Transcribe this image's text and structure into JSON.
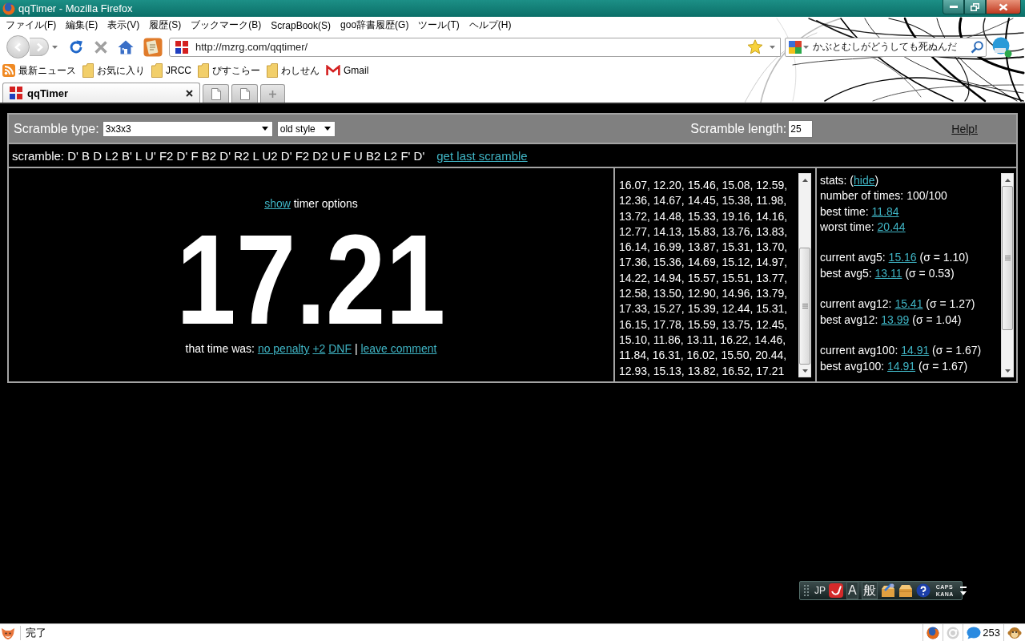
{
  "window": {
    "title": "qqTimer - Mozilla Firefox"
  },
  "menu_bar": [
    "ファイル(F)",
    "編集(E)",
    "表示(V)",
    "履歴(S)",
    "ブックマーク(B)",
    "ScrapBook(S)",
    "goo辞書履歴(G)",
    "ツール(T)",
    "ヘルプ(H)"
  ],
  "navigation": {
    "url": "http://mzrg.com/qqtimer/",
    "search_value": "かぶとむしがどうしても死ぬんだ"
  },
  "bookmarks": [
    {
      "kind": "feed",
      "label": "最新ニュース"
    },
    {
      "kind": "folder",
      "label": "お気に入り"
    },
    {
      "kind": "folder",
      "label": "JRCC"
    },
    {
      "kind": "folder",
      "label": "ぴすこらー"
    },
    {
      "kind": "folder",
      "label": "わしせん"
    },
    {
      "kind": "mail",
      "label": "Gmail"
    }
  ],
  "tabs": [
    {
      "kind": "site",
      "label": "qqTimer",
      "selected": true
    },
    {
      "kind": "blank",
      "selected": false
    },
    {
      "kind": "blank",
      "selected": false
    }
  ],
  "options_bar": {
    "type_label": "Scramble type:",
    "type_value": "3x3x3",
    "style_value": "old style",
    "length_label": "Scramble length:",
    "length_value": "25",
    "help": "Help!"
  },
  "scramble": {
    "text": "scramble: D' B D L2 B' L U' F2 D' F B2 D' R2 L U2 D' F2 D2 U F U B2 L2 F' D'",
    "link": "get last scramble"
  },
  "timer": {
    "options_link": "show",
    "options_rest": " timer options",
    "time": "17.21",
    "penalty_label": "that time was: ",
    "penalty_links": [
      "no penalty",
      "+2",
      "DNF"
    ],
    "separator": "|",
    "comment_link": "leave comment"
  },
  "times_lines": [
    "16.07, 12.20, 15.46, 15.08, 12.59,",
    "12.36, 14.67, 14.45, 15.38, 11.98,",
    "13.72, 14.48, 15.33, 19.16, 14.16,",
    "12.77, 14.13, 15.83, 13.76, 13.83,",
    "16.14, 16.99, 13.87, 15.31, 13.70,",
    "17.36, 15.36, 14.69, 15.12, 14.97,",
    "14.22, 14.94, 15.57, 15.51, 13.77,",
    "12.58, 13.50, 12.90, 14.96, 13.79,",
    "17.33, 15.27, 15.39, 12.44, 15.31,",
    "16.15, 17.78, 15.59, 13.75, 12.45,",
    "15.10, 11.86, 13.11, 16.22, 14.46,",
    "11.84, 16.31, 16.02, 15.50, 20.44,",
    "12.93, 15.13, 13.82, 16.52, 17.21"
  ],
  "stats": [
    [
      {
        "label": "stats: (",
        "link": "hide",
        "suffix": ")"
      },
      {
        "label": "number of times: 100/100"
      },
      {
        "label": "best time: ",
        "link": "11.84"
      },
      {
        "label": "worst time: ",
        "link": "20.44"
      }
    ],
    [
      {
        "label": "current avg5: ",
        "link": "15.16",
        "suffix": " (σ = 1.10)"
      },
      {
        "label": "best avg5: ",
        "link": "13.11",
        "suffix": " (σ = 0.53)"
      }
    ],
    [
      {
        "label": "current avg12: ",
        "link": "15.41",
        "suffix": " (σ = 1.27)"
      },
      {
        "label": "best avg12: ",
        "link": "13.99",
        "suffix": " (σ = 1.04)"
      }
    ],
    [
      {
        "label": "current avg100: ",
        "link": "14.91",
        "suffix": " (σ = 1.67)"
      },
      {
        "label": "best avg100: ",
        "link": "14.91",
        "suffix": " (σ = 1.67)"
      }
    ]
  ],
  "ime_bar": {
    "language": "JP",
    "input_mode": "A",
    "conversion_mode": "般",
    "caps": "CAPS",
    "kana": "KANA"
  },
  "status_bar": {
    "text": "完了",
    "count": "253"
  }
}
